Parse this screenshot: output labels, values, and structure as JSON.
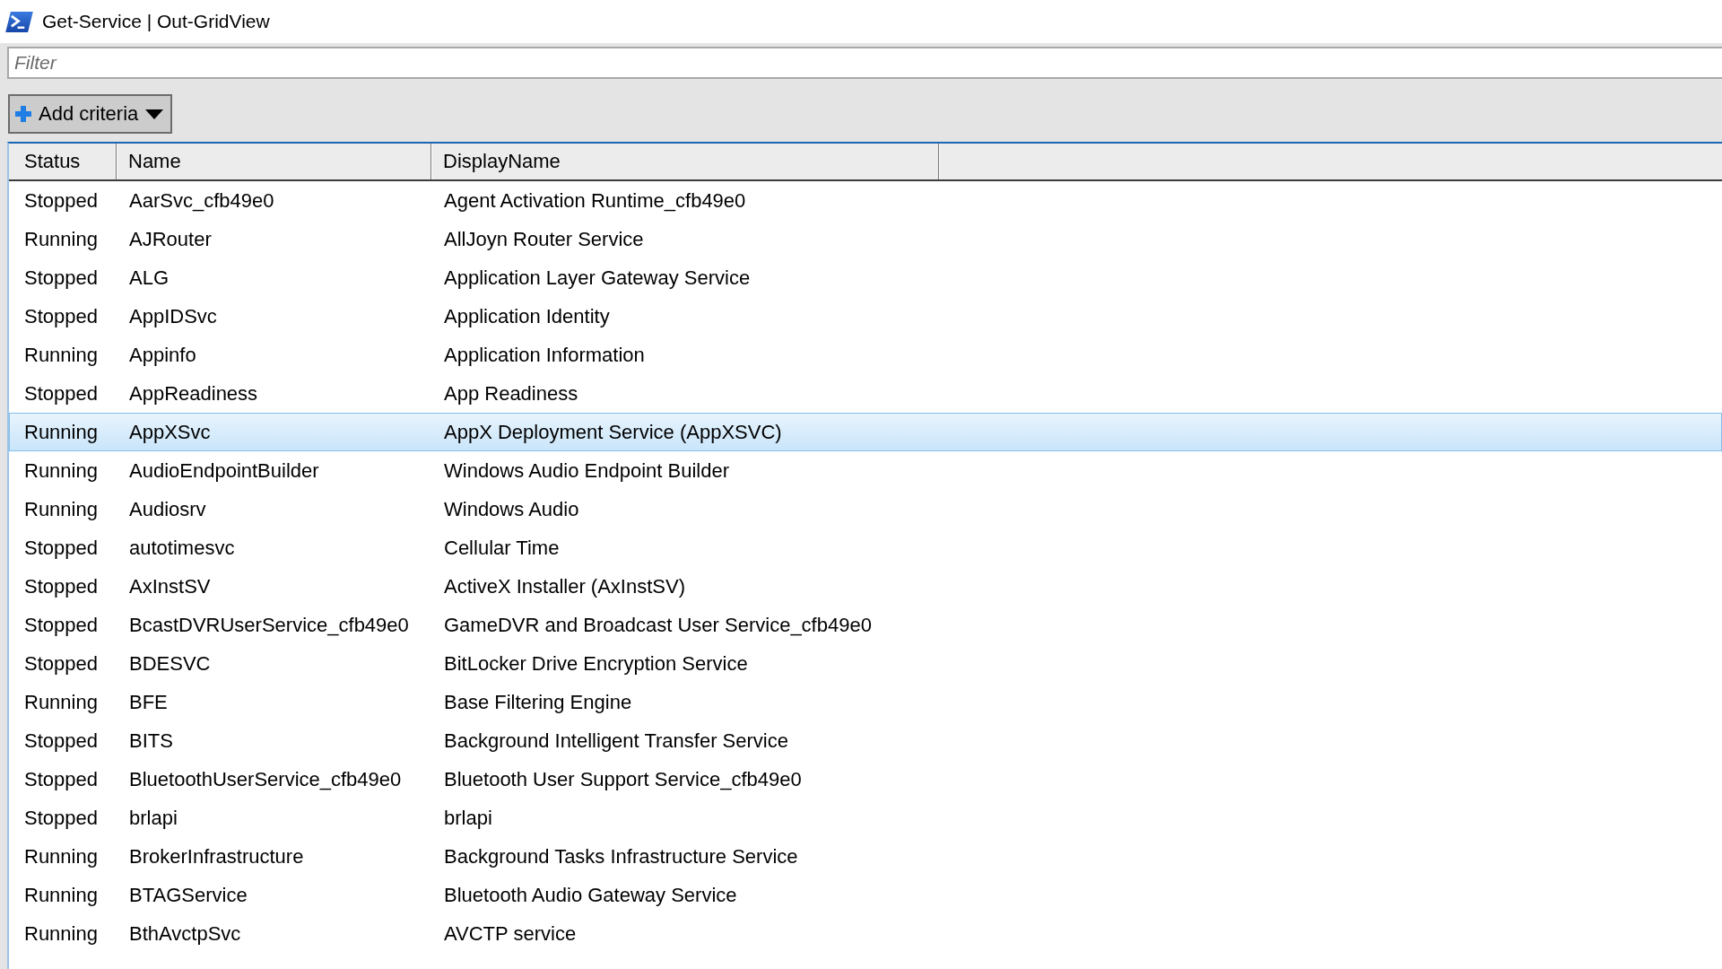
{
  "window": {
    "title": "Get-Service | Out-GridView"
  },
  "filter": {
    "placeholder": "Filter"
  },
  "add_criteria_button": {
    "label": "Add criteria"
  },
  "table": {
    "columns": [
      "Status",
      "Name",
      "DisplayName"
    ],
    "rows": [
      {
        "cells": [
          "Stopped",
          "AarSvc_cfb49e0",
          "Agent Activation Runtime_cfb49e0"
        ],
        "selected": false
      },
      {
        "cells": [
          "Running",
          "AJRouter",
          "AllJoyn Router Service"
        ],
        "selected": false
      },
      {
        "cells": [
          "Stopped",
          "ALG",
          "Application Layer Gateway Service"
        ],
        "selected": false
      },
      {
        "cells": [
          "Stopped",
          "AppIDSvc",
          "Application Identity"
        ],
        "selected": false
      },
      {
        "cells": [
          "Running",
          "Appinfo",
          "Application Information"
        ],
        "selected": false
      },
      {
        "cells": [
          "Stopped",
          "AppReadiness",
          "App Readiness"
        ],
        "selected": false
      },
      {
        "cells": [
          "Running",
          "AppXSvc",
          "AppX Deployment Service (AppXSVC)"
        ],
        "selected": true
      },
      {
        "cells": [
          "Running",
          "AudioEndpointBuilder",
          "Windows Audio Endpoint Builder"
        ],
        "selected": false
      },
      {
        "cells": [
          "Running",
          "Audiosrv",
          "Windows Audio"
        ],
        "selected": false
      },
      {
        "cells": [
          "Stopped",
          "autotimesvc",
          "Cellular Time"
        ],
        "selected": false
      },
      {
        "cells": [
          "Stopped",
          "AxInstSV",
          "ActiveX Installer (AxInstSV)"
        ],
        "selected": false
      },
      {
        "cells": [
          "Stopped",
          "BcastDVRUserService_cfb49e0",
          "GameDVR and Broadcast User Service_cfb49e0"
        ],
        "selected": false
      },
      {
        "cells": [
          "Stopped",
          "BDESVC",
          "BitLocker Drive Encryption Service"
        ],
        "selected": false
      },
      {
        "cells": [
          "Running",
          "BFE",
          "Base Filtering Engine"
        ],
        "selected": false
      },
      {
        "cells": [
          "Stopped",
          "BITS",
          "Background Intelligent Transfer Service"
        ],
        "selected": false
      },
      {
        "cells": [
          "Stopped",
          "BluetoothUserService_cfb49e0",
          "Bluetooth User Support Service_cfb49e0"
        ],
        "selected": false
      },
      {
        "cells": [
          "Stopped",
          "brlapi",
          "brlapi"
        ],
        "selected": false
      },
      {
        "cells": [
          "Running",
          "BrokerInfrastructure",
          "Background Tasks Infrastructure Service"
        ],
        "selected": false
      },
      {
        "cells": [
          "Running",
          "BTAGService",
          "Bluetooth Audio Gateway Service"
        ],
        "selected": false
      },
      {
        "cells": [
          "Running",
          "BthAvctpSvc",
          "AVCTP service"
        ],
        "selected": false
      }
    ]
  }
}
